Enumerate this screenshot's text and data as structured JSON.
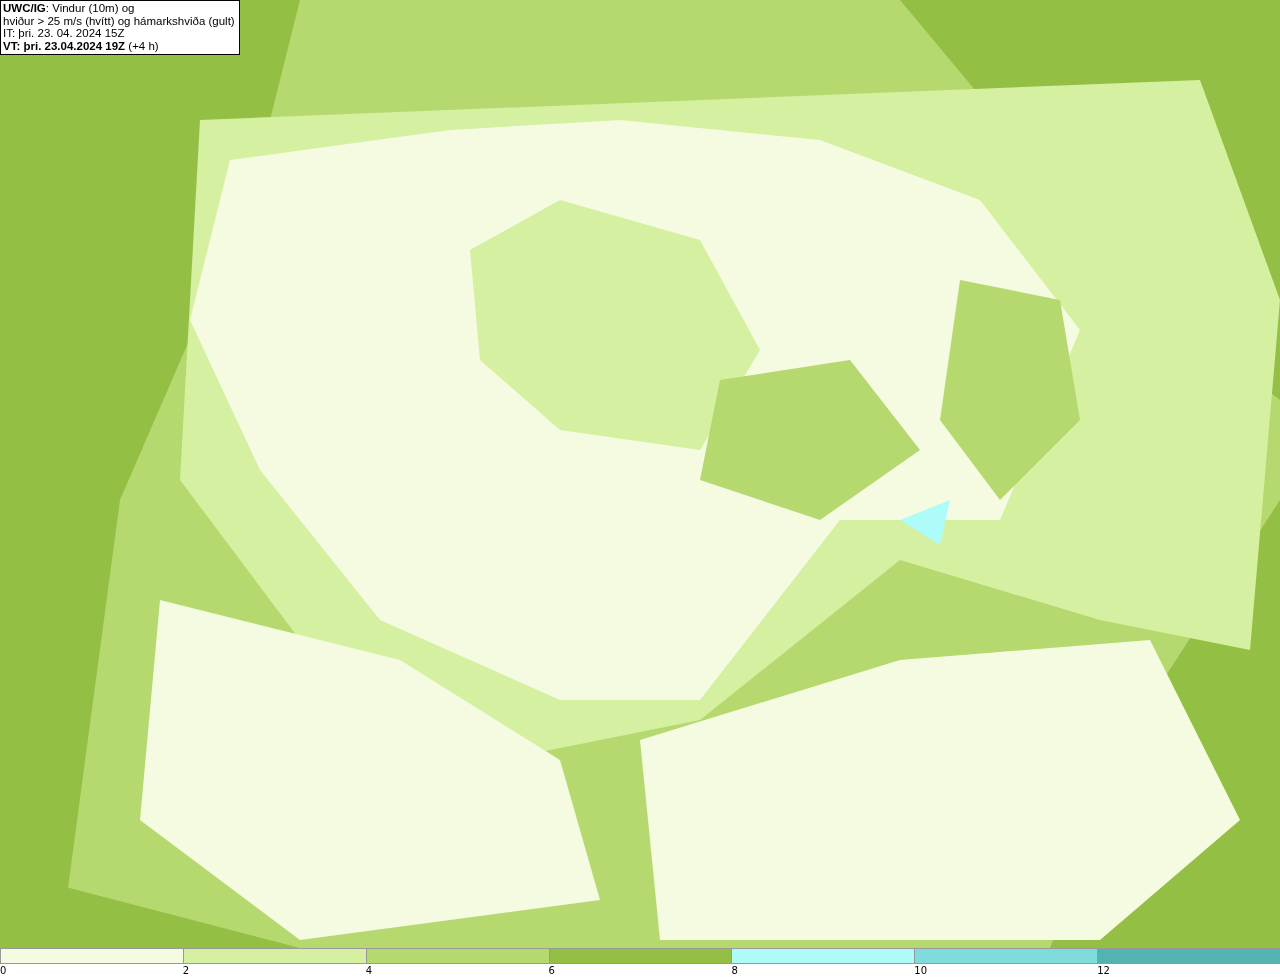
{
  "title_box": {
    "lines": [
      "**UWC/IG**: Vindur (10m) og",
      "hviður > 25 m/s (hvítt) og hámarkshviða (gult)",
      "IT: þri. 23. 04. 2024 15Z",
      "**VT: þri. 23.04.2024 19Z** (+4 h)"
    ]
  },
  "legend": [
    {
      "label": "0",
      "color": "#f4fbe0"
    },
    {
      "label": "2",
      "color": "#d4f0a0"
    },
    {
      "label": "4",
      "color": "#b5d96f"
    },
    {
      "label": "6",
      "color": "#94bf45"
    },
    {
      "label": "8",
      "color": "#adfcfa"
    },
    {
      "label": "10",
      "color": "#80dcdc"
    },
    {
      "label": "12",
      "color": "#52b3b3"
    }
  ]
}
